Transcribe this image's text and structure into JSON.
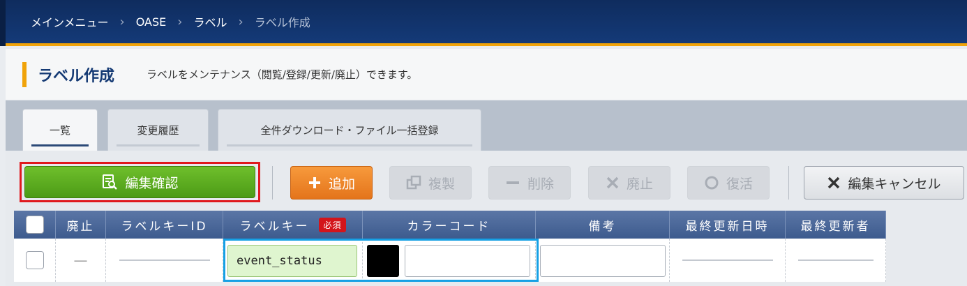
{
  "breadcrumb": {
    "items": [
      "メインメニュー",
      "OASE",
      "ラベル"
    ],
    "current": "ラベル作成",
    "separator": "›"
  },
  "page": {
    "title": "ラベル作成",
    "description": "ラベルをメンテナンス（閲覧/登録/更新/廃止）できます。"
  },
  "tabs": [
    {
      "label": "一覧",
      "active": true
    },
    {
      "label": "変更履歴",
      "active": false
    },
    {
      "label": "全件ダウンロード・ファイル一括登録",
      "active": false
    }
  ],
  "toolbar": {
    "confirm_label": "編集確認",
    "add_label": "追加",
    "duplicate_label": "複製",
    "delete_label": "削除",
    "discard_label": "廃止",
    "restore_label": "復活",
    "cancel_label": "編集キャンセル"
  },
  "table": {
    "headers": {
      "discard": "廃止",
      "label_key_id": "ラベルキーID",
      "label_key": "ラベルキー",
      "required": "必須",
      "color_code": "カラーコード",
      "remarks": "備考",
      "updated_at": "最終更新日時",
      "updated_by": "最終更新者"
    },
    "row": {
      "discard": "—",
      "label_key_value": "event_status",
      "color_swatch": "#000000",
      "color_code_value": "",
      "remarks_value": ""
    }
  },
  "colors": {
    "header_bg": "#143a78",
    "accent": "#f0a30a",
    "confirm": "#5aae1f",
    "add": "#ef8a2c",
    "highlight_red": "#e0191e",
    "highlight_blue": "#16a0e4"
  }
}
